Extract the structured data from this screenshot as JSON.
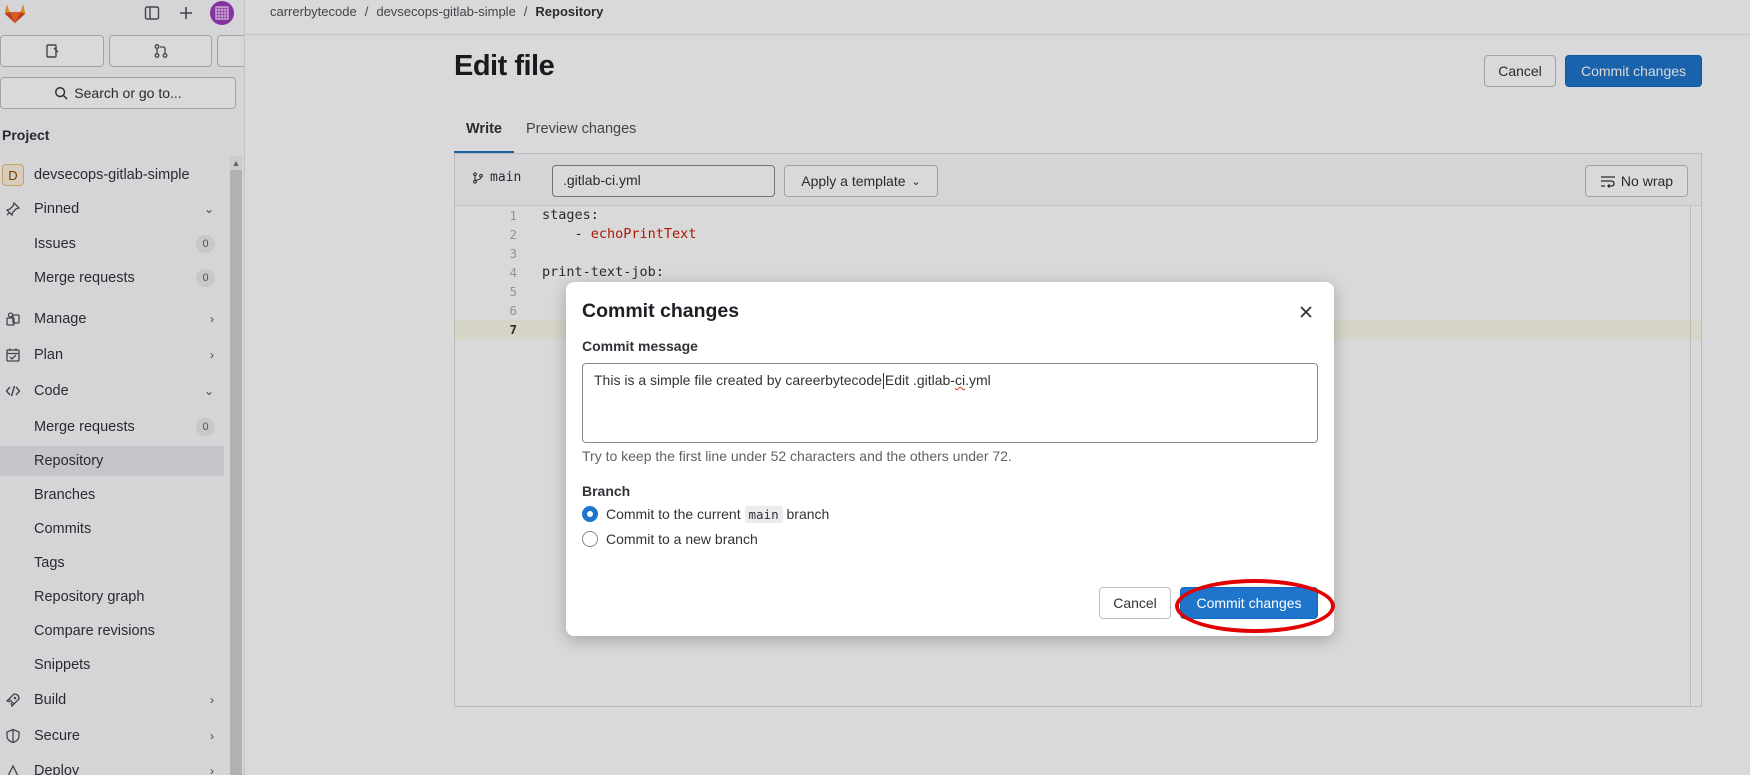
{
  "sidebar": {
    "search_label": "Search or go to...",
    "section_title": "Project",
    "project_name": "devsecops-gitlab-simple",
    "project_letter": "D",
    "items": [
      {
        "label": "Pinned"
      },
      {
        "label": "Issues",
        "count": "0"
      },
      {
        "label": "Merge requests",
        "count": "0"
      },
      {
        "label": "Manage"
      },
      {
        "label": "Plan"
      },
      {
        "label": "Code"
      },
      {
        "label": "Merge requests",
        "count": "0"
      },
      {
        "label": "Repository"
      },
      {
        "label": "Branches"
      },
      {
        "label": "Commits"
      },
      {
        "label": "Tags"
      },
      {
        "label": "Repository graph"
      },
      {
        "label": "Compare revisions"
      },
      {
        "label": "Snippets"
      },
      {
        "label": "Build"
      },
      {
        "label": "Secure"
      },
      {
        "label": "Deploy"
      }
    ]
  },
  "breadcrumb": {
    "items": [
      "carrerbytecode",
      "devsecops-gitlab-simple",
      "Repository"
    ],
    "separator": "/"
  },
  "page": {
    "title": "Edit file",
    "cancel_label": "Cancel",
    "commit_label": "Commit changes",
    "tabs": [
      "Write",
      "Preview changes"
    ]
  },
  "editor": {
    "branch": "main",
    "filename": ".gitlab-ci.yml",
    "template_label": "Apply a template",
    "nowrap_label": "No wrap",
    "lines": [
      {
        "num": "1",
        "text": "stages:"
      },
      {
        "num": "2",
        "text": "    - ",
        "str": "echoPrintText"
      },
      {
        "num": "3",
        "text": ""
      },
      {
        "num": "4",
        "text": "print-text-job:"
      },
      {
        "num": "5",
        "text": ""
      },
      {
        "num": "6",
        "text": ""
      },
      {
        "num": "7",
        "text": ""
      }
    ]
  },
  "modal": {
    "title": "Commit changes",
    "message_label": "Commit message",
    "message_part1": "This is a simple file created by careerbytecode",
    "message_part2": "Edit .gitlab-",
    "message_part3": "ci",
    "message_part4": ".yml",
    "help_text": "Try to keep the first line under 52 characters and the others under 72.",
    "branch_label": "Branch",
    "option_current_prefix": "Commit to the current",
    "option_current_branch": "main",
    "option_current_suffix": "branch",
    "option_new": "Commit to a new branch",
    "cancel_label": "Cancel",
    "commit_label": "Commit changes"
  },
  "colors": {
    "primary": "#1f75cb",
    "highlight_ring": "#e30000"
  }
}
